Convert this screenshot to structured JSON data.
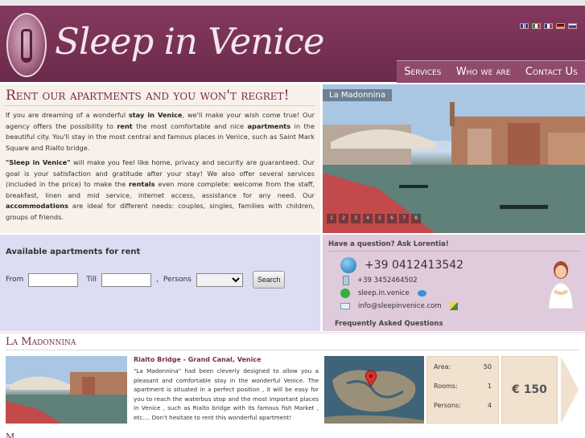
{
  "site": {
    "logo_text": "Sleep in Venice",
    "languages": [
      "en",
      "it",
      "fr",
      "de",
      "ru"
    ]
  },
  "nav": {
    "items": [
      "Services",
      "Who we are",
      "Contact Us"
    ]
  },
  "intro": {
    "heading": "Rent our apartments and you won't regret!",
    "p1_parts": [
      "If you are dreaming of a wonderful ",
      "stay in Venice",
      ", we'll make your wish come true! Our agency offers the possibility to ",
      "rent",
      " the most comfortable and nice ",
      "apartments",
      " in the beautiful city. You'll stay in the most central and famous places in Venice, such as Saint Mark Square and Rialto bridge."
    ],
    "p2_parts": [
      "\"Sleep in Venice\"",
      " will make you feel like home, privacy and security are guaranteed. Our goal is your satisfaction and gratitude after your stay! We also offer several services (included in the price) to make the ",
      "rentals",
      " even more complete: welcome from the staff, breakfast, linen and mid service, internet access, assistance for any need. Our ",
      "accommodations",
      " are ideal for different needs: couples, singles, families with children, groups of friends."
    ]
  },
  "slideshow": {
    "caption": "La Madonnina",
    "pages": [
      "1",
      "2",
      "3",
      "4",
      "5",
      "6",
      "7",
      "8"
    ]
  },
  "search": {
    "heading": "Available apartments for rent",
    "from_label": "From",
    "till_label": "Till",
    "persons_label": "Persons",
    "from_value": "",
    "till_value": "",
    "persons_value": "",
    "button": "Search"
  },
  "contact": {
    "question": "Have a question? Ask Lorentia!",
    "phone": "+39 0412413542",
    "mobile": "+39 3452464502",
    "skype": "sleep.in.venice",
    "email": "info@sleepinvenice.com",
    "faq": "Frequently Asked Questions"
  },
  "listing": {
    "section_title": "La Madonnina",
    "title": "Rialto Bridge - Grand Canal, Venice",
    "description": "\"La Madonnina\" had been cleverly designed to allow you a pleasant and comfortable stay in the wonderful Venice. The apartment is situated in a perfect position , it will be easy for you to reach the waterbus stop and the most important places in Venice , such as Rialto bridge with its famous fish Market , etc.... Don't hesitate to rent this wonderful apartment!",
    "area_label": "Area:",
    "area": "50",
    "rooms_label": "Rooms:",
    "rooms": "1",
    "persons_label": "Persons:",
    "persons": "4",
    "price": "€ 150"
  },
  "next_section_initial": "M",
  "colors": {
    "brand": "#7a3356",
    "accent_text": "#7a2a50",
    "search_bg": "#dcdcf2",
    "contact_bg": "#dfcbdb",
    "info_bg": "#f1e2cf"
  }
}
